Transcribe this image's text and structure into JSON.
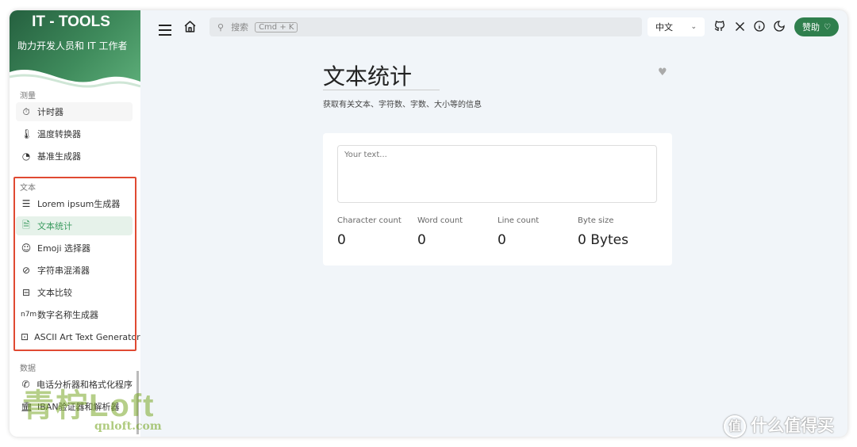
{
  "brand": {
    "title": "IT - TOOLS",
    "subtitle": "助力开发人员和 IT 工作者"
  },
  "sidebar": {
    "groups": [
      {
        "label": "测量",
        "items": [
          {
            "label": "计时器",
            "icon": "timer-icon"
          },
          {
            "label": "温度转换器",
            "icon": "thermometer-icon"
          },
          {
            "label": "基准生成器",
            "icon": "speedometer-icon"
          }
        ]
      },
      {
        "label": "文本",
        "items": [
          {
            "label": "Lorem ipsum生成器",
            "icon": "align-left-icon"
          },
          {
            "label": "文本统计",
            "icon": "file-text-icon",
            "active": true
          },
          {
            "label": "Emoji 选择器",
            "icon": "mood-smile-icon"
          },
          {
            "label": "字符串混淆器",
            "icon": "eye-off-icon"
          },
          {
            "label": "文本比较",
            "icon": "file-diff-icon"
          },
          {
            "label": "数字名称生成器",
            "icon": "n-m-icon"
          },
          {
            "label": "ASCII Art Text Generator",
            "icon": "focus-icon"
          }
        ]
      },
      {
        "label": "数据",
        "items": [
          {
            "label": "电话分析器和格式化程序",
            "icon": "phone-icon"
          },
          {
            "label": "IBAN验证器和解析器",
            "icon": "bank-icon"
          }
        ]
      }
    ],
    "group0_label": "测量",
    "group1_label": "文本",
    "group2_label": "数据",
    "items": [
      "计时器",
      "温度转换器",
      "基准生成器",
      "Lorem ipsum生成器",
      "文本统计",
      "Emoji 选择器",
      "字符串混淆器",
      "文本比较",
      "数字名称生成器",
      "ASCII Art Text Generator",
      "电话分析器和格式化程序",
      "IBAN验证器和解析器"
    ]
  },
  "header": {
    "search_placeholder": "搜索",
    "search_shortcut": "Cmd + K",
    "language": "中文",
    "donate_label": "赞助"
  },
  "main": {
    "title": "文本统计",
    "description": "获取有关文本、字符数、字数、大小等的信息",
    "textarea_placeholder": "Your text...",
    "stats": [
      {
        "label": "Character count",
        "value": "0"
      },
      {
        "label": "Word count",
        "value": "0"
      },
      {
        "label": "Line count",
        "value": "0"
      },
      {
        "label": "Byte size",
        "value": "0 Bytes"
      }
    ]
  },
  "watermark": {
    "text": "青柠Loft",
    "url": "qnloft.com",
    "corner": "什么值得买",
    "corner_badge": "值"
  },
  "colors": {
    "accent": "#3a9b5f",
    "brand": "#2f7f4d",
    "highlight": "#e04a32"
  }
}
